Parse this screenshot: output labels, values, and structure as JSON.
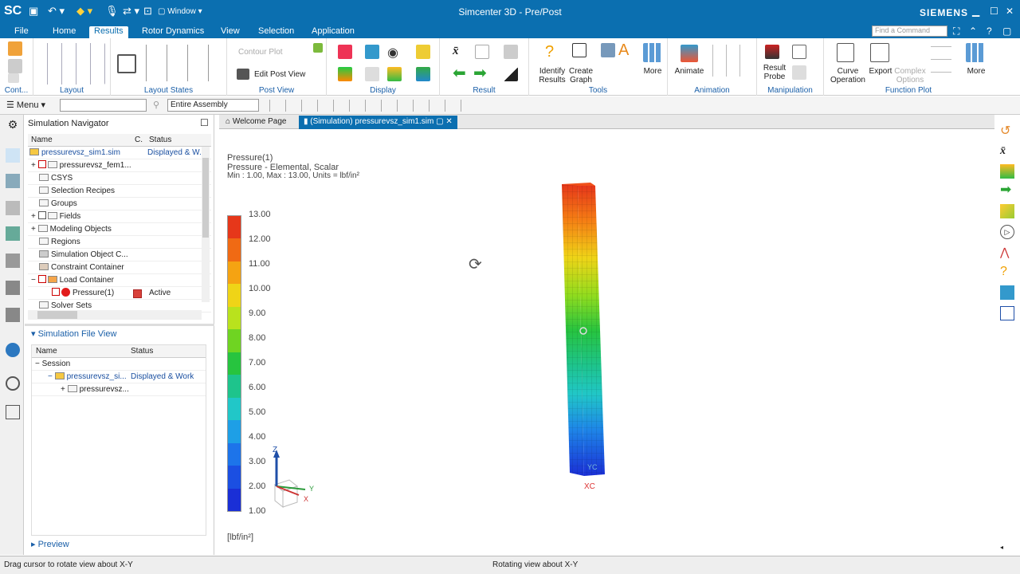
{
  "titlebar": {
    "logo": "SC",
    "window_menu": "Window",
    "title": "Simcenter 3D - Pre/Post",
    "brand": "SIEMENS"
  },
  "menubar": {
    "items": [
      "File",
      "Home",
      "Results",
      "Rotor Dynamics",
      "View",
      "Selection",
      "Application"
    ],
    "active": "Results",
    "find_placeholder": "Find a Command"
  },
  "ribbon": {
    "groups": [
      "Cont...",
      "Layout",
      "Layout States",
      "Post View",
      "Display",
      "Result",
      "Tools",
      "Animation",
      "Manipulation",
      "Function Plot"
    ],
    "buttons": {
      "contour_plot": "Contour Plot",
      "edit_post_view": "Edit Post View",
      "identify_results": "Identify Results",
      "create_graph": "Create Graph",
      "more1": "More",
      "animate": "Animate",
      "result_probe": "Result Probe",
      "curve_operation": "Curve Operation",
      "export": "Export",
      "complex_options": "Complex Options",
      "more2": "More"
    }
  },
  "toolbar": {
    "menu": "Menu",
    "filter": "",
    "scope": "Entire Assembly"
  },
  "navigator": {
    "title": "Simulation Navigator",
    "columns": [
      "Name",
      "C.",
      "Status"
    ],
    "rows": [
      {
        "name": "pressurevsz_sim1.sim",
        "status": "Displayed & W."
      },
      {
        "name": "pressurevsz_fem1..."
      },
      {
        "name": "CSYS"
      },
      {
        "name": "Selection Recipes"
      },
      {
        "name": "Groups"
      },
      {
        "name": "Fields"
      },
      {
        "name": "Modeling Objects"
      },
      {
        "name": "Regions"
      },
      {
        "name": "Simulation Object C..."
      },
      {
        "name": "Constraint Container"
      },
      {
        "name": "Load Container"
      },
      {
        "name": "Pressure(1)",
        "status": "Active"
      },
      {
        "name": "Solver Sets"
      }
    ],
    "file_view_title": "Simulation File View",
    "file_columns": [
      "Name",
      "Status"
    ],
    "file_rows": [
      {
        "name": "Session"
      },
      {
        "name": "pressurevsz_si...",
        "status": "Displayed & Work"
      },
      {
        "name": "pressurevsz..."
      }
    ],
    "preview": "Preview"
  },
  "tabs": {
    "welcome": "Welcome Page",
    "sim": "(Simulation) pressurevsz_sim1.sim"
  },
  "view": {
    "result_name": "Pressure(1)",
    "result_type": "Pressure - Elemental, Scalar",
    "result_range": "Min : 1.00, Max : 13.00, Units = lbf/in²",
    "unit_label": "[lbf/in²]",
    "legend_values": [
      "13.00",
      "12.00",
      "11.00",
      "10.00",
      "9.00",
      "8.00",
      "7.00",
      "6.00",
      "5.00",
      "4.00",
      "3.00",
      "2.00",
      "1.00"
    ],
    "legend_colors": [
      "#e6371a",
      "#f06a14",
      "#f5a312",
      "#efd417",
      "#b9e21d",
      "#6fd422",
      "#27c43f",
      "#1ec48c",
      "#21c7c8",
      "#1e9fe6",
      "#1d74ea",
      "#1b4fe2",
      "#1a2fd6"
    ],
    "axis_labels": {
      "z": "Z",
      "y": "Y",
      "x": "X",
      "xc": "XC",
      "yc": "YC"
    }
  },
  "statusbar": {
    "left": "Drag cursor to rotate view about X-Y",
    "center": "Rotating view about X-Y"
  }
}
